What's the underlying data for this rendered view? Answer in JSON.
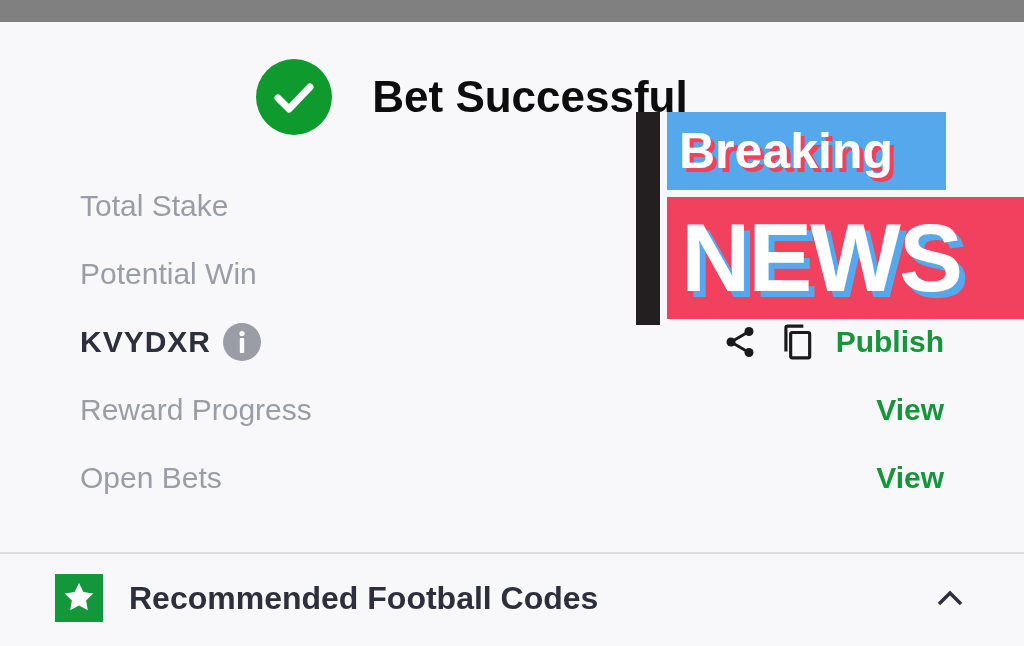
{
  "header": {
    "title": "Bet Successful"
  },
  "rows": [
    {
      "kind": "amount",
      "label": "Total Stake"
    },
    {
      "kind": "amount",
      "label": "Potential Win"
    },
    {
      "kind": "code",
      "label": "KVYDXR",
      "action": "Publish"
    },
    {
      "kind": "link",
      "label": "Reward Progress",
      "action": "View"
    },
    {
      "kind": "link",
      "label": "Open Bets",
      "action": "View"
    }
  ],
  "section": {
    "title": "Recommended Football Codes",
    "expanded": true
  },
  "sticker": {
    "top": "Breaking",
    "bottom": "NEWS"
  }
}
